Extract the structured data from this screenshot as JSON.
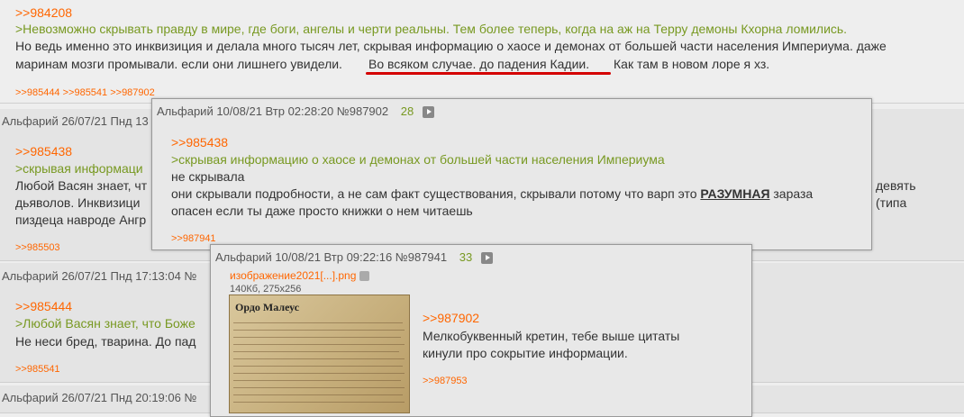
{
  "post1": {
    "num": ">>984208",
    "quote": ">Невозможно скрывать правду в мире, где боги, ангелы и черти реальны. Тем более теперь, когда на аж на Терру демоны Кхорна ломились.",
    "line1": "Но ведь именно это инквизиция и делала много тысяч лет, скрывая информацию о хаосе и демонах от большей части населения Империума. даже",
    "line2_a": "маринам мозги промывали. если они лишнего увидели.",
    "line2_b": "Во всяком случае. до падения Кадии.",
    "line2_c": "Как там в новом лоре я хз.",
    "replies": ">>985444 >>985541 >>987902"
  },
  "post2": {
    "header": "Альфарий 26/07/21 Пнд 13",
    "num": ">>985438",
    "quote": ">скрывая информаци",
    "line1": "Любой Васян знает, чт",
    "line1_right": "девять",
    "line2": "дьяволов. Инквизици",
    "line2_right": "(типа",
    "line3": "пиздеца навроде Ангр",
    "replies": ">>985503"
  },
  "post3": {
    "header": "Альфарий 26/07/21 Пнд 17:13:04  №",
    "num": ">>985444",
    "quote": ">Любой Васян знает, что Боже",
    "line1": "Не неси бред, тварина. До пад",
    "replies": ">>985541"
  },
  "post4": {
    "header": "Альфарий 26/07/21 Пнд 20:19:06  №"
  },
  "popup1": {
    "header": "Альфарий 10/08/21 Втр 02:28:20  №987902",
    "count": "28",
    "num": ">>985438",
    "quote": ">скрывая информацию о хаосе и демонах от большей части населения Империума",
    "line1": "не скрывала",
    "line2_a": "они скрывали подробности, а не сам факт существования, скрывали потому что варп это ",
    "line2_b": "РАЗУМНАЯ",
    "line2_c": " зараза",
    "line3": "опасен если ты даже просто книжки о нем читаешь",
    "replies": ">>987941"
  },
  "popup2": {
    "header": "Альфарий 10/08/21 Втр 09:22:16  №987941",
    "count": "33",
    "file_name": "изображение2021[...].png",
    "file_meta": "140Кб, 275x256",
    "image_title": "Ордо Малеус",
    "num": ">>987902",
    "line1": "Мелкобуквенный кретин, тебе выше цитаты",
    "line2": "кинули про сокрытие информации.",
    "replies": ">>987953"
  },
  "colors": {
    "link": "#ff6600",
    "greentext": "#789922",
    "underline": "#d40000"
  }
}
